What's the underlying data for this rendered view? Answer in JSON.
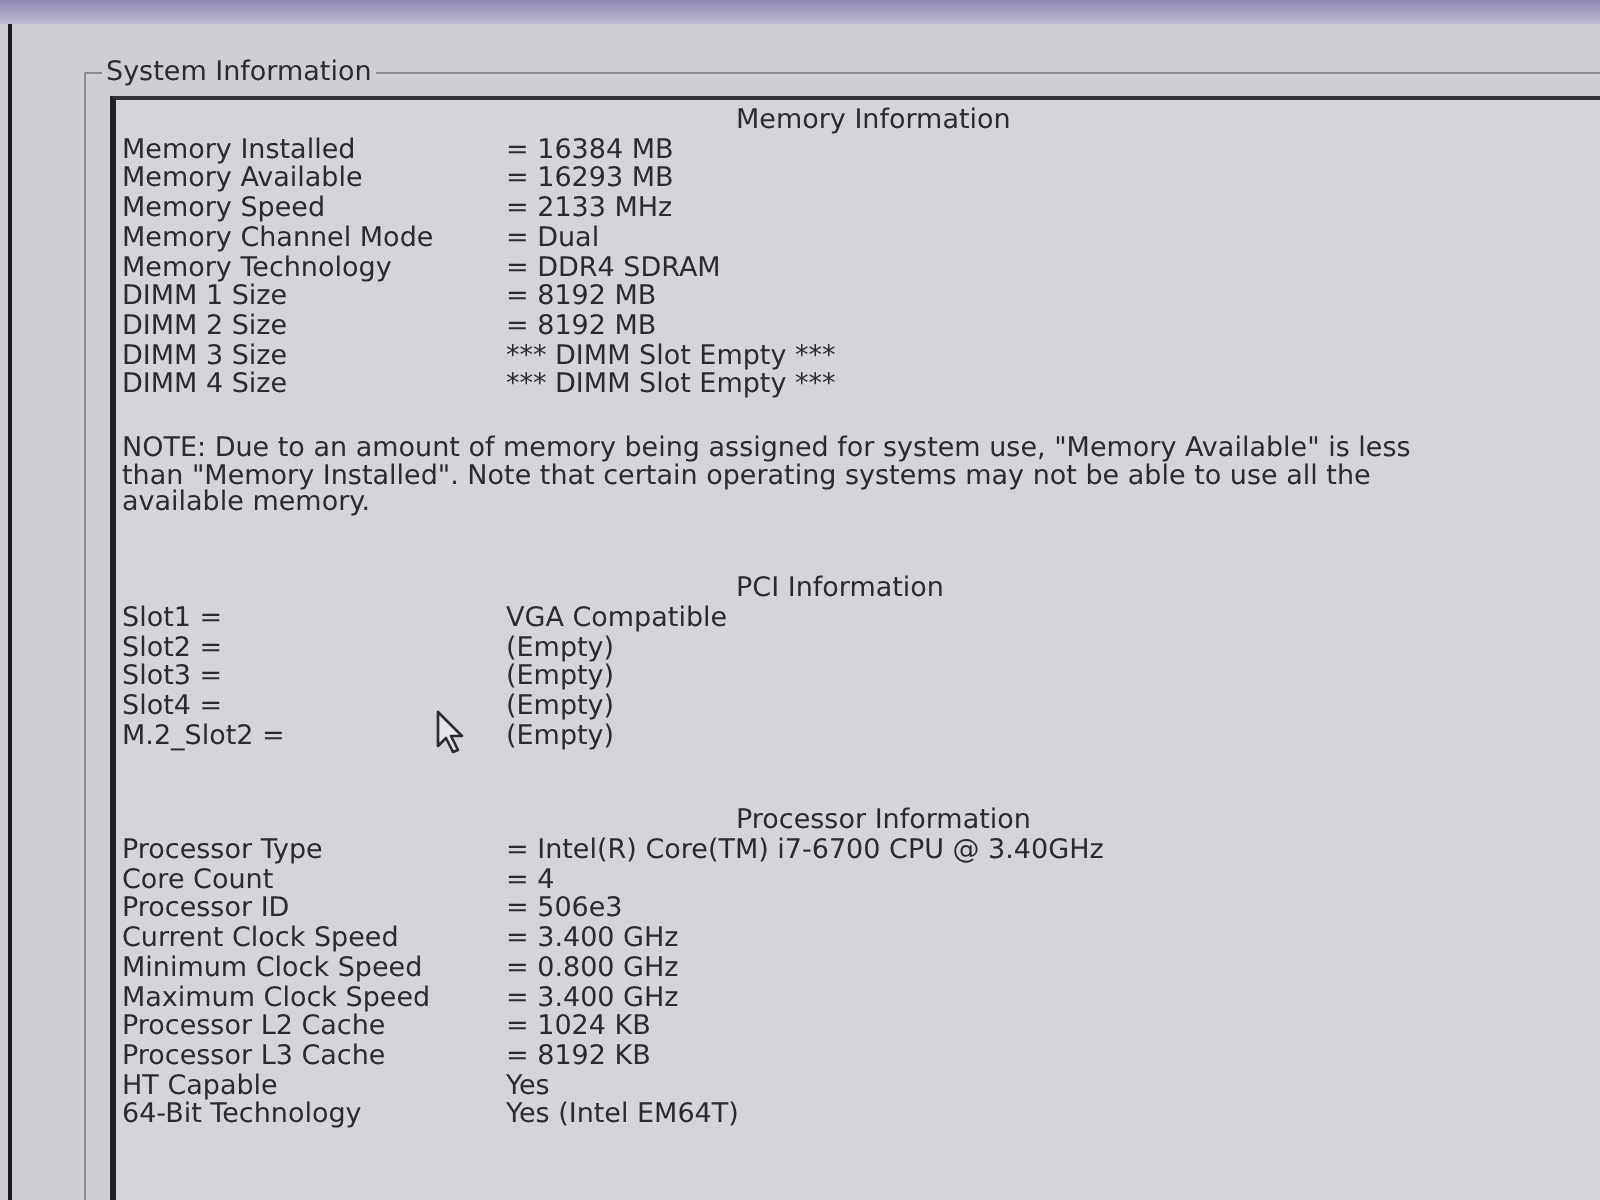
{
  "group_box": {
    "title": "System Information"
  },
  "sections": [
    {
      "heading": "Memory Information",
      "rows": [
        {
          "label": "Memory Installed",
          "value": "= 16384 MB"
        },
        {
          "label": "Memory Available",
          "value": "= 16293 MB"
        },
        {
          "label": "Memory Speed",
          "value": "= 2133 MHz"
        },
        {
          "label": "Memory Channel Mode",
          "value": "= Dual"
        },
        {
          "label": "Memory Technology",
          "value": "= DDR4 SDRAM"
        },
        {
          "label": "DIMM 1 Size",
          "value": "= 8192 MB"
        },
        {
          "label": "DIMM 2 Size",
          "value": "= 8192 MB"
        },
        {
          "label": "DIMM 3 Size",
          "value": "*** DIMM Slot Empty ***"
        },
        {
          "label": "DIMM 4 Size",
          "value": "*** DIMM Slot Empty ***"
        }
      ],
      "note": "NOTE: Due to an amount of memory being assigned for system use, \"Memory Available\" is less than \"Memory Installed\". Note that certain operating systems may not be able to use all the available memory."
    },
    {
      "heading": "PCI Information",
      "rows": [
        {
          "label": "Slot1 =",
          "value": "VGA Compatible"
        },
        {
          "label": "Slot2 =",
          "value": "(Empty)"
        },
        {
          "label": "Slot3 =",
          "value": "(Empty)"
        },
        {
          "label": "Slot4 =",
          "value": "(Empty)"
        },
        {
          "label": "M.2_Slot2 =",
          "value": "(Empty)"
        }
      ]
    },
    {
      "heading": "Processor Information",
      "rows": [
        {
          "label": "Processor Type",
          "value": "= Intel(R) Core(TM) i7-6700 CPU @ 3.40GHz"
        },
        {
          "label": "Core Count",
          "value": "= 4"
        },
        {
          "label": "Processor ID",
          "value": "= 506e3"
        },
        {
          "label": "Current Clock Speed",
          "value": "= 3.400 GHz"
        },
        {
          "label": "Minimum Clock Speed",
          "value": "= 0.800 GHz"
        },
        {
          "label": "Maximum Clock Speed",
          "value": "= 3.400 GHz"
        },
        {
          "label": "Processor L2 Cache",
          "value": "= 1024 KB"
        },
        {
          "label": "Processor L3 Cache",
          "value": "= 8192 KB"
        },
        {
          "label": "HT Capable",
          "value": "Yes"
        },
        {
          "label": "64-Bit Technology",
          "value": "Yes (Intel EM64T)"
        }
      ]
    }
  ]
}
